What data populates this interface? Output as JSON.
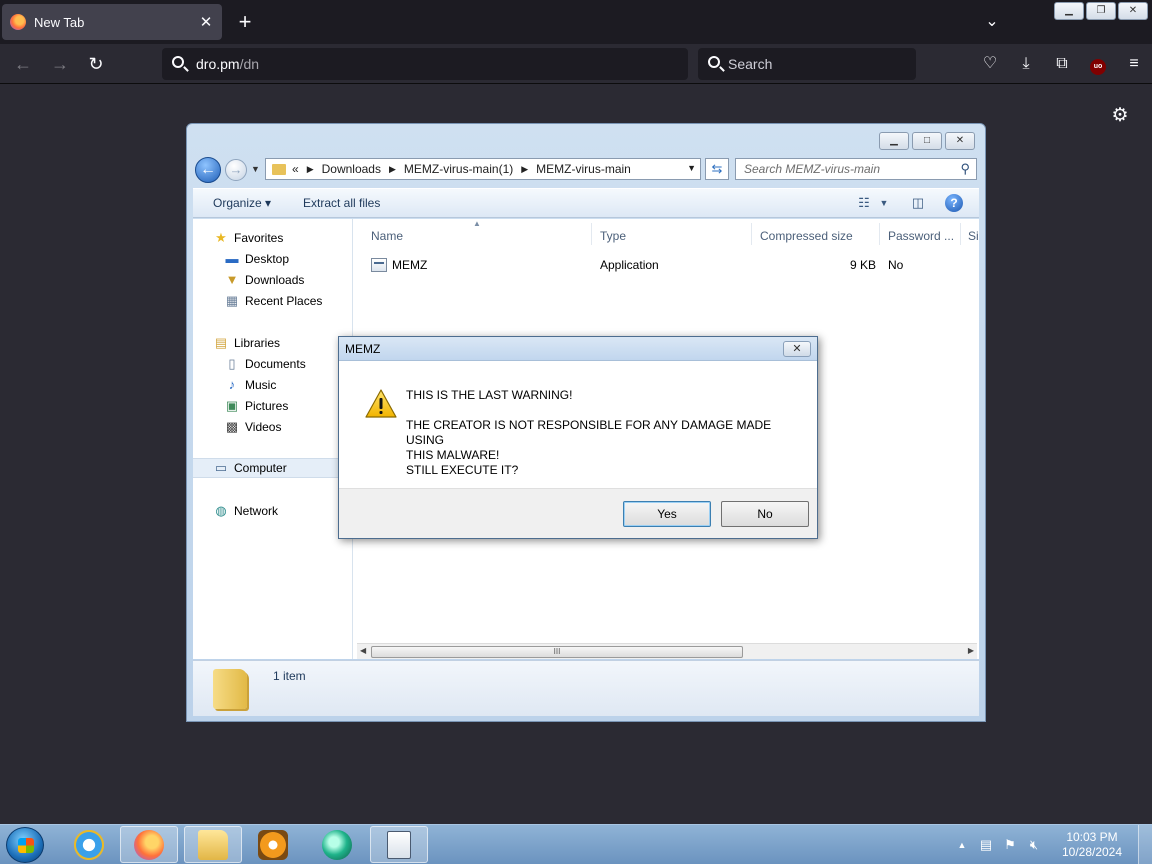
{
  "browser": {
    "tab_title": "New Tab",
    "url_host": "dro.pm",
    "url_path": "/dn",
    "search_placeholder": "Search",
    "icons": [
      "firefox-icon",
      "close-icon",
      "plus-icon",
      "chevron-down-icon",
      "back-arrow-icon",
      "forward-arrow-icon",
      "reload-icon",
      "search-icon",
      "pocket-icon",
      "download-icon",
      "extensions-icon",
      "ublock-icon",
      "hamburger-menu-icon",
      "gear-icon"
    ],
    "ublock_label": "uo"
  },
  "explorer": {
    "breadcrumb": [
      "Downloads",
      "MEMZ-virus-main(1)",
      "MEMZ-virus-main"
    ],
    "crumb_prefix": "«",
    "search_placeholder": "Search MEMZ-virus-main",
    "toolbar": {
      "organize": "Organize ▾",
      "extract": "Extract all files"
    },
    "nav": {
      "favorites": "Favorites",
      "desktop": "Desktop",
      "downloads": "Downloads",
      "recent": "Recent Places",
      "libraries": "Libraries",
      "documents": "Documents",
      "music": "Music",
      "pictures": "Pictures",
      "videos": "Videos",
      "computer": "Computer",
      "network": "Network"
    },
    "columns": {
      "name": "Name",
      "type": "Type",
      "compressed": "Compressed size",
      "password": "Password ...",
      "size": "Si"
    },
    "files": [
      {
        "name": "MEMZ",
        "type": "Application",
        "compressed": "9 KB",
        "password": "No"
      }
    ],
    "status": "1 item",
    "scroll_grip": "III"
  },
  "dialog": {
    "title": "MEMZ",
    "line1": "THIS IS THE LAST WARNING!",
    "line2": "THE CREATOR IS NOT RESPONSIBLE FOR ANY DAMAGE MADE USING",
    "line3": "THIS MALWARE!",
    "line4": "STILL EXECUTE IT?",
    "yes": "Yes",
    "no": "No"
  },
  "taskbar": {
    "time": "10:03 PM",
    "date": "10/28/2024"
  },
  "colors": {
    "firefox_bg": "#2b2a33",
    "taskbar": "#7aa0c8",
    "dialog_footer": "#f0f0f0"
  }
}
